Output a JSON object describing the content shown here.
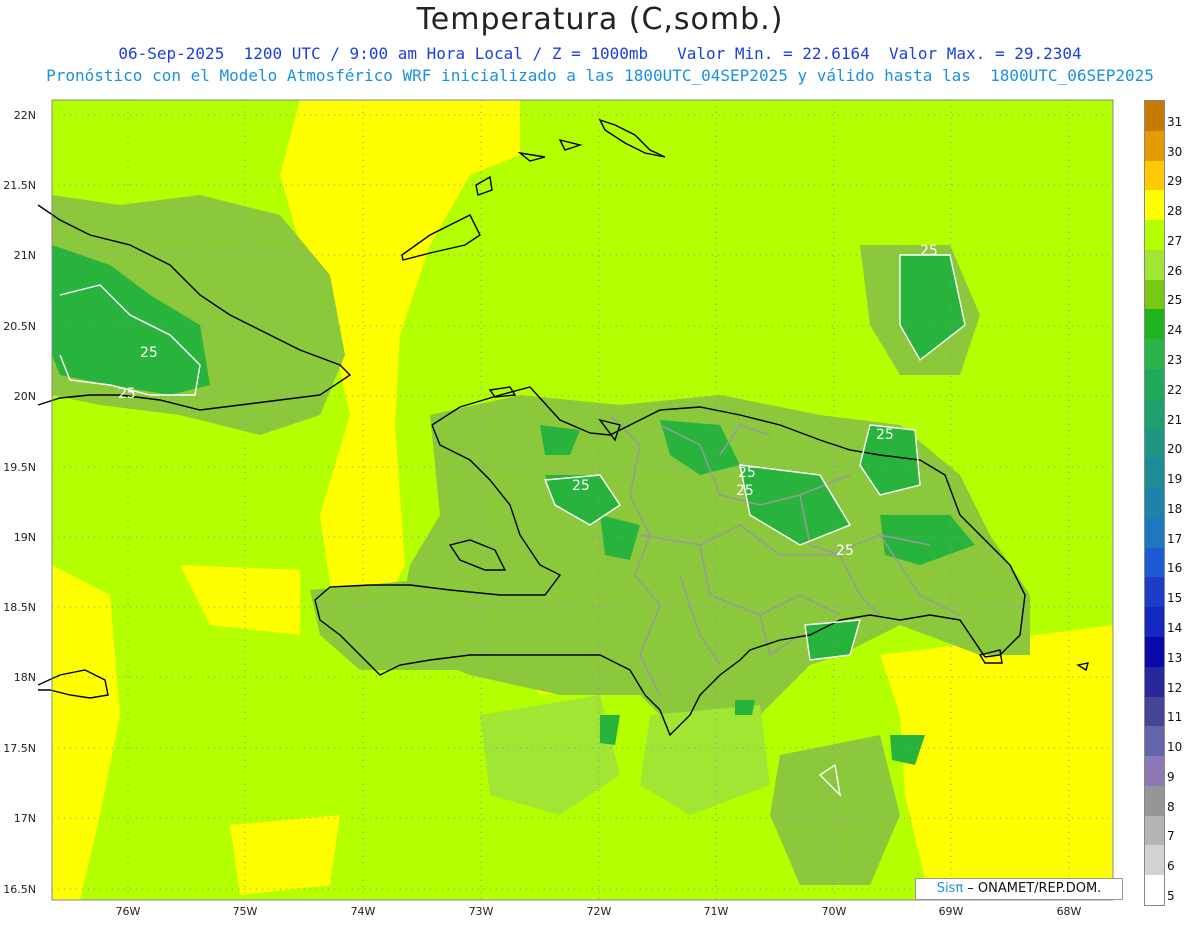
{
  "header": {
    "title": "Temperatura (C,somb.)",
    "line1": "06-Sep-2025  1200 UTC / 9:00 am Hora Local / Z = 1000mb   Valor Min. = 22.6164  Valor Max. = 29.2304",
    "line2": "Pronóstico con el Modelo Atmosférico WRF inicializado a las 1800UTC_04SEP2025 y válido hasta las  1800UTC_06SEP2025"
  },
  "credit": {
    "logo": "Sisπ",
    "org": " – ONAMET/REP.DOM."
  },
  "axes": {
    "lat_ticks": [
      "22N",
      "21.5N",
      "21N",
      "20.5N",
      "20N",
      "19.5N",
      "19N",
      "18.5N",
      "18N",
      "17.5N",
      "17N",
      "16.5N"
    ],
    "lon_ticks": [
      "76W",
      "75W",
      "74W",
      "73W",
      "72W",
      "71W",
      "70W",
      "69W",
      "68W"
    ]
  },
  "contour_labels": [
    "25",
    "25",
    "25",
    "25",
    "25",
    "25",
    "25",
    "25"
  ],
  "legend": {
    "levels": [
      "31",
      "30",
      "29",
      "28",
      "27",
      "26",
      "25",
      "24",
      "23",
      "22",
      "21",
      "20",
      "19",
      "18",
      "17",
      "16",
      "15",
      "14",
      "13",
      "12",
      "11",
      "10",
      "9",
      "8",
      "7",
      "6",
      "5"
    ],
    "colors": [
      "#c67a00",
      "#e69a00",
      "#ffc800",
      "#ffff00",
      "#b4ff00",
      "#a0e632",
      "#78c814",
      "#1eb41e",
      "#28b446",
      "#1eaa5a",
      "#1ea06e",
      "#1e9682",
      "#1e8c96",
      "#1e82aa",
      "#1e78be",
      "#1e5ad2",
      "#1e3cc8",
      "#1428be",
      "#0a0aaa",
      "#28289c",
      "#464696",
      "#6464aa",
      "#8c78b4",
      "#969696",
      "#b4b4b4",
      "#d2d2d2",
      "#ffffff"
    ]
  },
  "colors": {
    "sea": "#b4ff00",
    "warm": "#ffff00",
    "land": "#8cc83c",
    "cool": "#28b43c"
  }
}
